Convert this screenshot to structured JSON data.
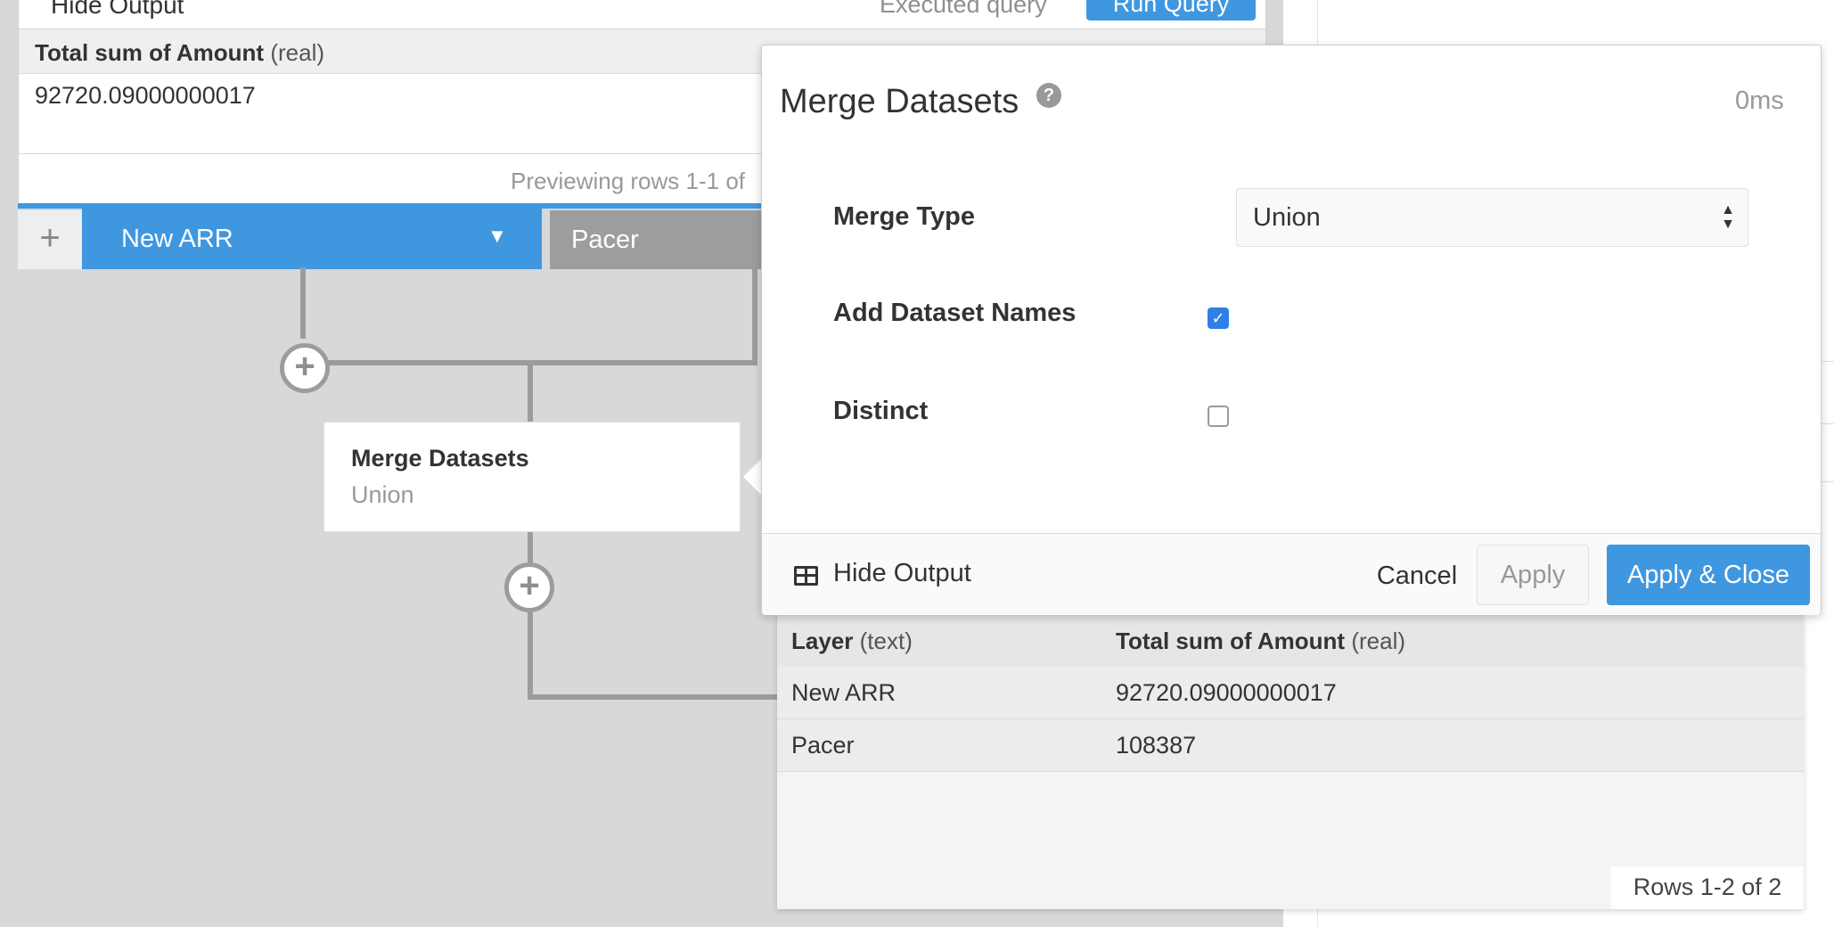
{
  "top_panel": {
    "hide_output_label": "Hide Output",
    "executed_label": "Executed query",
    "run_query_label": "Run Query",
    "column_header_name": "Total sum of Amount",
    "column_header_type": "(real)",
    "cell_value": "92720.09000000017",
    "previewing_text": "Previewing rows 1-1 of"
  },
  "tabs": {
    "add_symbol": "+",
    "active_tab": "New ARR",
    "active_caret": "▼",
    "second_tab": "Pacer"
  },
  "flow": {
    "plus_symbol": "+",
    "node_title": "Merge Datasets",
    "node_subtitle": "Union"
  },
  "modal": {
    "title": "Merge Datasets",
    "help_symbol": "?",
    "timing": "0ms",
    "merge_type_label": "Merge Type",
    "merge_type_value": "Union",
    "add_dataset_names_label": "Add Dataset Names",
    "add_dataset_names_checked": true,
    "distinct_label": "Distinct",
    "distinct_checked": false,
    "hide_output_label": "Hide Output",
    "cancel_label": "Cancel",
    "apply_label": "Apply",
    "apply_close_label": "Apply & Close"
  },
  "results": {
    "headers": [
      {
        "name": "Layer",
        "type": "(text)"
      },
      {
        "name": "Total sum of Amount",
        "type": "(real)"
      }
    ],
    "rows": [
      [
        "New ARR",
        "92720.09000000017"
      ],
      [
        "Pacer",
        "108387"
      ]
    ],
    "rows_count": "Rows 1-2 of 2"
  },
  "colors": {
    "accent": "#3f97e0",
    "checkbox": "#2f7fe6",
    "connector": "#9c9c9c"
  }
}
